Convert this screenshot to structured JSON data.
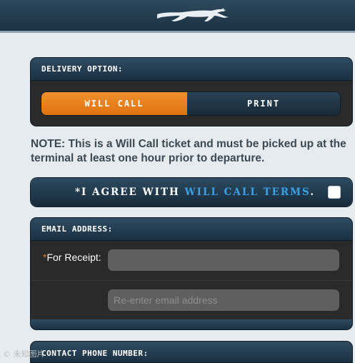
{
  "header": {
    "logo_icon": "greyhound-dog-logo-icon"
  },
  "delivery": {
    "title": "DELIVERY OPTION:",
    "options": [
      {
        "label": "WILL CALL",
        "selected": true
      },
      {
        "label": "PRINT",
        "selected": false
      }
    ],
    "accent_color": "#e97d1a"
  },
  "note": "NOTE: This is a Will Call ticket and must be picked up at the terminal at least one hour prior to departure.",
  "agree": {
    "prefix": "*I AGREE WITH ",
    "link_text": "WILL CALL TERMS",
    "suffix": ".",
    "checked": false,
    "link_color": "#3aa1e8"
  },
  "email": {
    "title": "EMAIL ADDRESS:",
    "required_marker": "*",
    "label": "For Receipt:",
    "value": "",
    "confirm_placeholder": "Re-enter email address"
  },
  "contact": {
    "title": "CONTACT PHONE NUMBER:"
  },
  "watermark": "© 未知图片"
}
